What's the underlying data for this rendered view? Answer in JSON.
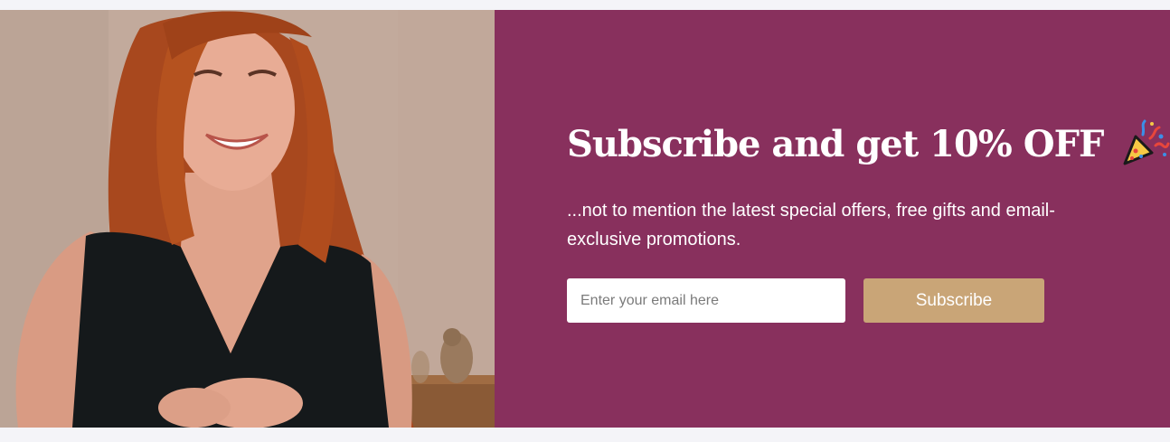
{
  "banner": {
    "headline": "Subscribe and get 10% OFF",
    "headline_icon": "party-popper-icon",
    "subtext": "...not to mention the latest special offers, free gifts and email-exclusive promotions.",
    "email_placeholder": "Enter your email here",
    "email_value": "",
    "button_label": "Subscribe"
  },
  "colors": {
    "panel_background": "#88305d",
    "button_background": "#c9a577",
    "text": "#ffffff"
  }
}
